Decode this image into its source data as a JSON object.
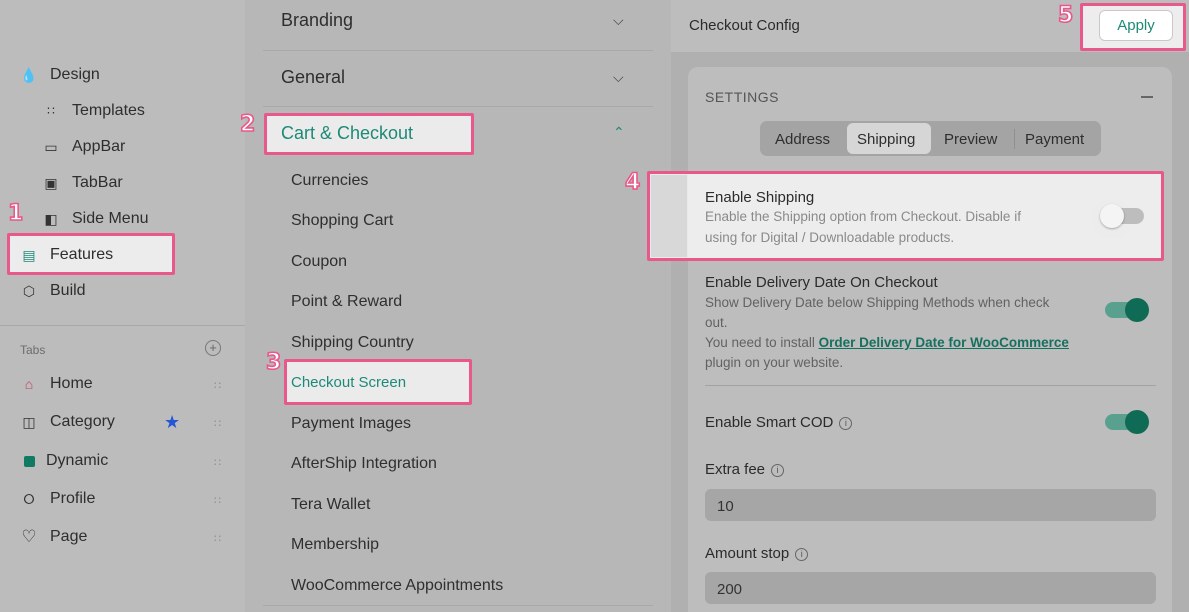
{
  "sidebar": {
    "design": "Design",
    "items": [
      "Templates",
      "AppBar",
      "TabBar",
      "Side Menu"
    ],
    "features": "Features",
    "build": "Build",
    "tabs_header": "Tabs",
    "tabs": [
      "Home",
      "Category",
      "Dynamic",
      "Profile",
      "Page"
    ]
  },
  "middle": {
    "sections": [
      "Branding",
      "General",
      "Cart & Checkout"
    ],
    "subitems": [
      "Currencies",
      "Shopping Cart",
      "Coupon",
      "Point & Reward",
      "Shipping Country",
      "Checkout Screen",
      "Payment Images",
      "AfterShip Integration",
      "Tera Wallet",
      "Membership",
      "WooCommerce Appointments"
    ]
  },
  "right": {
    "title": "Checkout Config",
    "apply": "Apply",
    "settings": "SETTINGS",
    "tabs": [
      "Address",
      "Shipping",
      "Preview",
      "Payment"
    ],
    "enable_shipping": {
      "title": "Enable Shipping",
      "desc1": "Enable the Shipping option from Checkout. Disable if",
      "desc2": "using for Digital / Downloadable products."
    },
    "delivery": {
      "title": "Enable Delivery Date On Checkout",
      "desc1": "Show Delivery Date below Shipping Methods when check",
      "desc2": "out.",
      "desc3": "You need to install ",
      "link": "Order Delivery Date for WooCommerce",
      "desc4": "plugin on your website."
    },
    "smart_cod": "Enable Smart COD",
    "extra_fee_label": "Extra fee",
    "extra_fee_value": "10",
    "amount_stop_label": "Amount stop",
    "amount_stop_value": "200"
  },
  "annotations": [
    "1",
    "2",
    "3",
    "4",
    "5"
  ],
  "colors": {
    "accent": "#1c8a78",
    "highlight": "#e8588a",
    "toggle_on": "#0f6b55",
    "star": "#2456d6"
  }
}
